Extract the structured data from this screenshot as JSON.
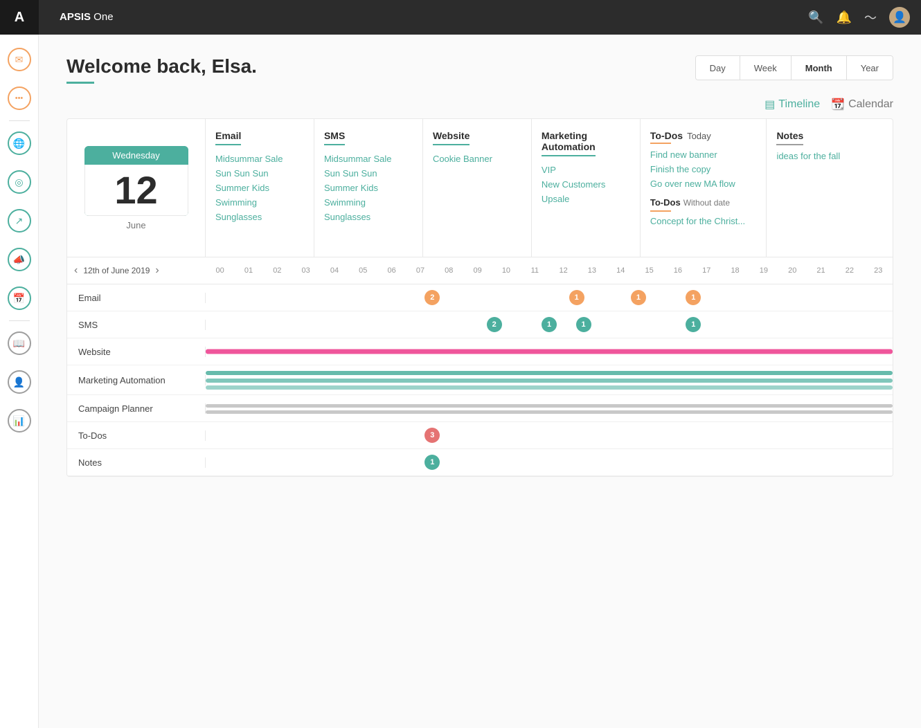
{
  "app": {
    "brand": "APSIS",
    "brand_sub": " One"
  },
  "header": {
    "welcome": "Welcome back, Elsa.",
    "title_underline_color": "#4caf9e"
  },
  "view_tabs": [
    {
      "label": "Day",
      "active": false
    },
    {
      "label": "Week",
      "active": false
    },
    {
      "label": "Month",
      "active": true
    },
    {
      "label": "Year",
      "active": false
    }
  ],
  "view_toggle": {
    "timeline_label": "Timeline",
    "calendar_label": "Calendar"
  },
  "date": {
    "day_name": "Wednesday",
    "day_number": "12",
    "month_name": "June"
  },
  "email_col": {
    "header": "Email",
    "items": [
      "Midsummar Sale",
      "Sun Sun Sun",
      "Summer Kids",
      "Swimming",
      "Sunglasses"
    ]
  },
  "sms_col": {
    "header": "SMS",
    "items": [
      "Midsummar Sale",
      "Sun Sun Sun",
      "Summer Kids",
      "Swimming",
      "Sunglasses"
    ]
  },
  "website_col": {
    "header": "Website",
    "items": [
      "Cookie Banner"
    ]
  },
  "marketing_col": {
    "header": "Marketing",
    "header2": "Automation",
    "items": [
      "VIP",
      "New Customers",
      "Upsale"
    ]
  },
  "todos_col": {
    "header": "To-Dos",
    "today_label": "Today",
    "items_today": [
      "Find new banner",
      "Finish the copy",
      "Go over new MA flow"
    ],
    "without_date_label": "Without date",
    "items_nodate": [
      "Concept for the Christ..."
    ]
  },
  "notes_col": {
    "header": "Notes",
    "items": [
      "ideas for the fall"
    ]
  },
  "timeline": {
    "date_label": "12th of June 2019",
    "hours": [
      "00",
      "01",
      "02",
      "03",
      "04",
      "05",
      "06",
      "07",
      "08",
      "09",
      "10",
      "11",
      "12",
      "13",
      "14",
      "15",
      "16",
      "17",
      "18",
      "19",
      "20",
      "21",
      "22",
      "23"
    ],
    "rows": [
      {
        "label": "Email"
      },
      {
        "label": "SMS"
      },
      {
        "label": "Website"
      },
      {
        "label": "Marketing Automation"
      },
      {
        "label": "Campaign Planner"
      },
      {
        "label": "To-Dos"
      },
      {
        "label": "Notes"
      }
    ]
  },
  "sidebar": {
    "items": [
      {
        "icon": "✉",
        "name": "email",
        "color": "#f4a261"
      },
      {
        "icon": "···",
        "name": "more",
        "color": "#f4a261"
      },
      {
        "icon": "⊕",
        "name": "globe",
        "color": "#4caf9e"
      },
      {
        "icon": "◎",
        "name": "target",
        "color": "#4caf9e"
      },
      {
        "icon": "↗",
        "name": "share",
        "color": "#4caf9e"
      },
      {
        "icon": "📢",
        "name": "megaphone",
        "color": "#4caf9e"
      },
      {
        "icon": "📅",
        "name": "calendar",
        "color": "#4caf9e"
      },
      {
        "icon": "📖",
        "name": "book",
        "color": "#9e9e9e"
      },
      {
        "icon": "👤",
        "name": "person",
        "color": "#9e9e9e"
      },
      {
        "icon": "📊",
        "name": "bar-chart",
        "color": "#9e9e9e"
      }
    ]
  }
}
